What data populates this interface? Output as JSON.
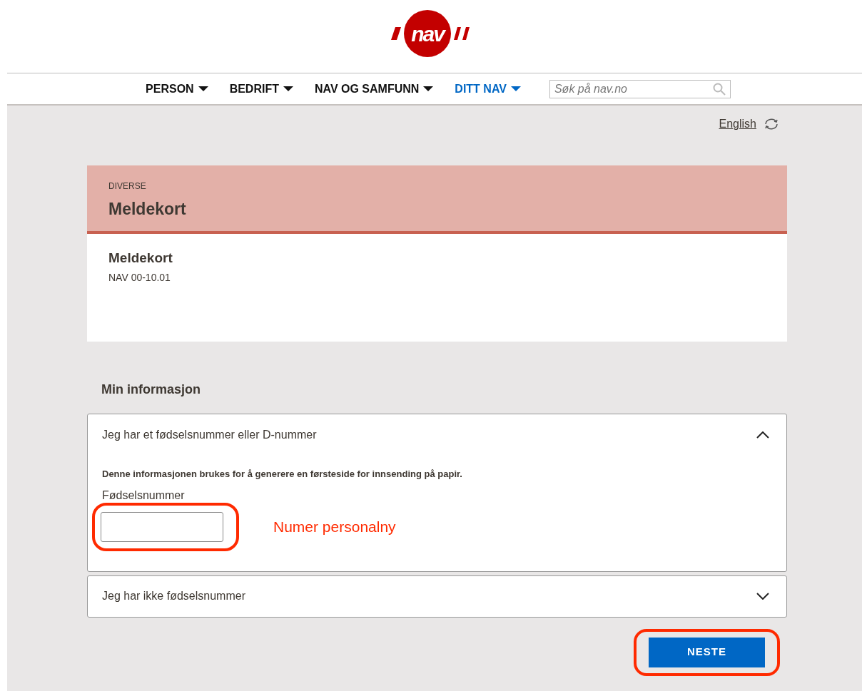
{
  "logo": {
    "text": "nav"
  },
  "nav": {
    "items": [
      {
        "label": "PERSON",
        "selected": false
      },
      {
        "label": "BEDRIFT",
        "selected": false
      },
      {
        "label": "NAV OG SAMFUNN",
        "selected": false
      },
      {
        "label": "DITT NAV",
        "selected": true
      }
    ],
    "search": {
      "placeholder": "Søk på nav.no"
    }
  },
  "language_link": "English",
  "form_header": {
    "category": "DIVERSE",
    "title": "Meldekort"
  },
  "form_info": {
    "title": "Meldekort",
    "code": "NAV 00-10.01"
  },
  "section_title": "Min informasjon",
  "accordions": [
    {
      "title": "Jeg har et fødselsnummer eller D-nummer",
      "expanded": true,
      "description": "Denne informasjonen brukes for å generere en førsteside for innsending på papir.",
      "field_label": "Fødselsnummer",
      "annotation": "Numer personalny"
    },
    {
      "title": "Jeg har ikke fødselsnummer",
      "expanded": false
    }
  ],
  "next_button": "NESTE"
}
